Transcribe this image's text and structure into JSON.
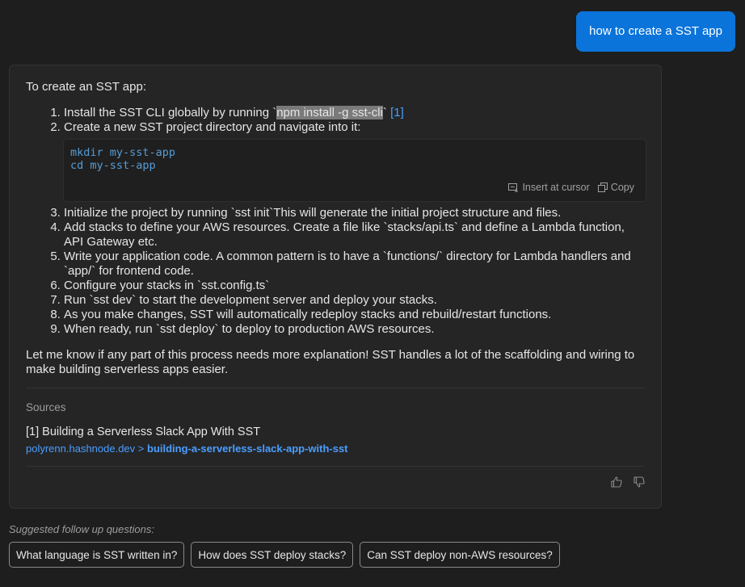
{
  "user_message": "how to create a SST app",
  "answer": {
    "intro": "To create an SST app:",
    "steps": [
      {
        "prefix": "Install the SST CLI globally by running `",
        "highlight": "npm install -g sst-cli",
        "suffix": "` ",
        "citation": "[1]"
      },
      {
        "text": "Create a new SST project directory and navigate into it:"
      },
      {
        "text": "Initialize the project by running `sst init`This will generate the initial project structure and files."
      },
      {
        "text": "Add stacks to define your AWS resources. Create a file like `stacks/api.ts` and define a Lambda function, API Gateway etc."
      },
      {
        "text": "Write your application code. A common pattern is to have a `functions/` directory for Lambda handlers and `app/` for frontend code."
      },
      {
        "text": "Configure your stacks in `sst.config.ts`"
      },
      {
        "text": "Run `sst dev` to start the development server and deploy your stacks."
      },
      {
        "text": "As you make changes, SST will automatically redeploy stacks and rebuild/restart functions."
      },
      {
        "text": "When ready, run `sst deploy` to deploy to production AWS resources."
      }
    ],
    "code": {
      "lines": [
        "mkdir my-sst-app",
        "cd my-sst-app"
      ],
      "insert_label": "Insert at cursor",
      "copy_label": "Copy"
    },
    "outro": "Let me know if any part of this process needs more explanation! SST handles a lot of the scaffolding and wiring to make building serverless apps easier.",
    "sources": {
      "title": "Sources",
      "items": [
        {
          "title": "[1] Building a Serverless Slack App With SST",
          "host": "polyrenn.hashnode.dev",
          "sep": " > ",
          "path": "building-a-serverless-slack-app-with-sst"
        }
      ]
    }
  },
  "suggestions": {
    "label": "Suggested follow up questions:",
    "items": [
      "What language is SST written in?",
      "How does SST deploy stacks?",
      "Can SST deploy non-AWS resources?"
    ]
  },
  "icons": {
    "insert": "insert-at-cursor-icon",
    "copy": "copy-icon",
    "thumbs_up": "thumbs-up-icon",
    "thumbs_down": "thumbs-down-icon"
  },
  "colors": {
    "accent": "#0a74da",
    "link": "#4a9eff",
    "code": "#569cd6",
    "background": "#1e1e1e",
    "card": "#252526"
  }
}
